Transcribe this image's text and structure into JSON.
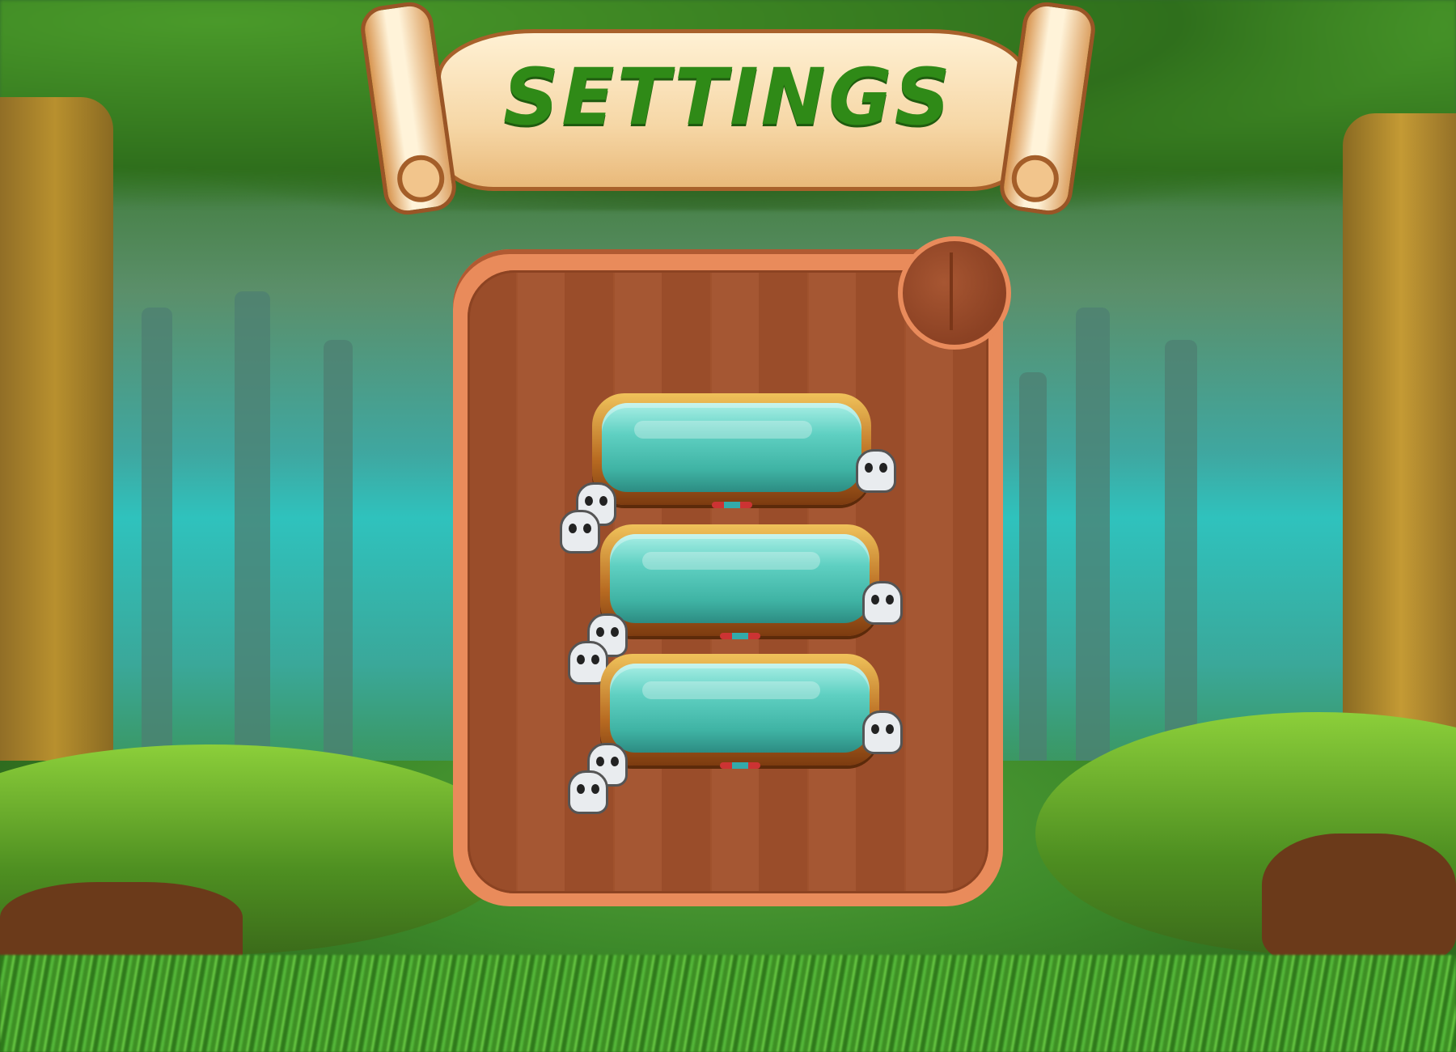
{
  "screen": {
    "title": "SETTINGS"
  },
  "colors": {
    "title_text": "#2f8a17",
    "board_border": "#e98b5b",
    "board_wood": "#9a4d2a",
    "slot_glass": "#5fd0c2",
    "slot_frame": "#b76a21",
    "scroll_paper": "#f6d7a6"
  },
  "icons": {
    "skull": "skull-icon"
  },
  "settings_board": {
    "slots": [
      {
        "label": ""
      },
      {
        "label": ""
      },
      {
        "label": ""
      }
    ]
  }
}
